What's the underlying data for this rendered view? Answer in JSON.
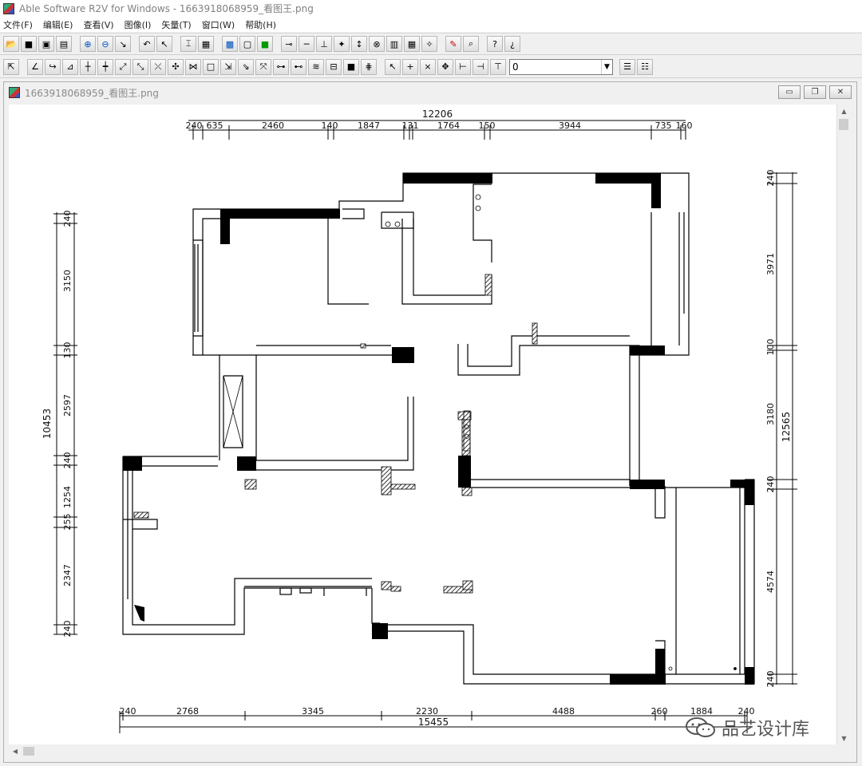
{
  "window": {
    "title": "Able Software R2V for Windows - 1663918068959_看图王.png"
  },
  "menu": [
    "文件(F)",
    "编辑(E)",
    "查看(V)",
    "图像(I)",
    "矢量(T)",
    "窗口(W)",
    "帮助(H)"
  ],
  "toolbar1": [
    {
      "name": "open-icon",
      "glyph": "📂"
    },
    {
      "name": "save-icon",
      "glyph": "■"
    },
    {
      "name": "save-all-icon",
      "glyph": "▣"
    },
    {
      "name": "disk-icon",
      "glyph": "▤"
    },
    {
      "name": "zoom-in-icon",
      "glyph": "⊕"
    },
    {
      "name": "zoom-out-icon",
      "glyph": "⊖"
    },
    {
      "name": "pan-icon",
      "glyph": "↘"
    },
    {
      "name": "undo-icon",
      "glyph": "↶"
    },
    {
      "name": "select-icon",
      "glyph": "↖"
    },
    {
      "name": "fit-icon",
      "glyph": "⌶"
    },
    {
      "name": "grid-icon",
      "glyph": "▦"
    },
    {
      "name": "image-icon",
      "glyph": "▩"
    },
    {
      "name": "frame-icon",
      "glyph": "▢"
    },
    {
      "name": "green-box-icon",
      "glyph": "■"
    },
    {
      "name": "line-node-icon",
      "glyph": "⊸"
    },
    {
      "name": "line-icon",
      "glyph": "─"
    },
    {
      "name": "tree-icon",
      "glyph": "⊥"
    },
    {
      "name": "point-icon",
      "glyph": "✦"
    },
    {
      "name": "anchor-icon",
      "glyph": "↕"
    },
    {
      "name": "circle-cross-icon",
      "glyph": "⊗"
    },
    {
      "name": "raster-icon",
      "glyph": "▥"
    },
    {
      "name": "raster2-icon",
      "glyph": "▦"
    },
    {
      "name": "star-icon",
      "glyph": "✧"
    },
    {
      "name": "pick-red-icon",
      "glyph": "✎"
    },
    {
      "name": "pick-icon",
      "glyph": "⌕"
    },
    {
      "name": "help-icon",
      "glyph": "?"
    },
    {
      "name": "context-help-icon",
      "glyph": "¿"
    }
  ],
  "toolbar2": [
    {
      "name": "pointer-icon",
      "glyph": "⇱"
    },
    {
      "name": "edit1-icon",
      "glyph": "∠"
    },
    {
      "name": "edit2-icon",
      "glyph": "↪"
    },
    {
      "name": "edit3-icon",
      "glyph": "⊿"
    },
    {
      "name": "edit4-icon",
      "glyph": "┼"
    },
    {
      "name": "edit5-icon",
      "glyph": "┿"
    },
    {
      "name": "edit6-icon",
      "glyph": "⤢"
    },
    {
      "name": "edit7-icon",
      "glyph": "⤡"
    },
    {
      "name": "edit8-icon",
      "glyph": "⤫"
    },
    {
      "name": "edit9-icon",
      "glyph": "✣"
    },
    {
      "name": "edit10-icon",
      "glyph": "⋈"
    },
    {
      "name": "rect-icon",
      "glyph": "□"
    },
    {
      "name": "edit11-icon",
      "glyph": "⇲"
    },
    {
      "name": "edit12-icon",
      "glyph": "⇘"
    },
    {
      "name": "edit13-icon",
      "glyph": "⤧"
    },
    {
      "name": "edit14-icon",
      "glyph": "⊶"
    },
    {
      "name": "edit15-icon",
      "glyph": "⊷"
    },
    {
      "name": "edit16-icon",
      "glyph": "≋"
    },
    {
      "name": "edit17-icon",
      "glyph": "⊟"
    },
    {
      "name": "fill-icon",
      "glyph": "■"
    },
    {
      "name": "edit18-icon",
      "glyph": "⋕"
    },
    {
      "name": "arrow-sel-icon",
      "glyph": "↖"
    },
    {
      "name": "node-add-icon",
      "glyph": "+"
    },
    {
      "name": "node-del-icon",
      "glyph": "×"
    },
    {
      "name": "node-move-icon",
      "glyph": "✥"
    },
    {
      "name": "node-1-icon",
      "glyph": "⊢"
    },
    {
      "name": "node-2-icon",
      "glyph": "⊣"
    },
    {
      "name": "node-3-icon",
      "glyph": "⊤"
    }
  ],
  "combo_value": "0",
  "toolbar2_end": [
    {
      "name": "layers-icon",
      "glyph": "☰"
    },
    {
      "name": "layer-list-icon",
      "glyph": "☷"
    }
  ],
  "child": {
    "title": "1663918068959_看图王.png"
  },
  "dims": {
    "top_total": "12206",
    "top_parts": [
      "240",
      "635",
      "2460",
      "140",
      "1847",
      "131",
      "1764",
      "150",
      "3944",
      "735",
      "160"
    ],
    "bottom_parts": [
      "240",
      "2768",
      "3345",
      "2230",
      "4488",
      "260",
      "1884",
      "240"
    ],
    "bottom_total": "15455",
    "left_parts": [
      "240",
      "3150",
      "130",
      "2597",
      "240",
      "1254",
      "255",
      "2347",
      "240"
    ],
    "left_total": "10453",
    "right_parts": [
      "240",
      "3971",
      "100",
      "3180",
      "240",
      "4574",
      "240"
    ],
    "right_total": "12565"
  },
  "watermark": "品艺设计库",
  "colors": {
    "wall": "#000000",
    "hatch": "#555555",
    "line": "#222222",
    "background": "#ffffff"
  }
}
